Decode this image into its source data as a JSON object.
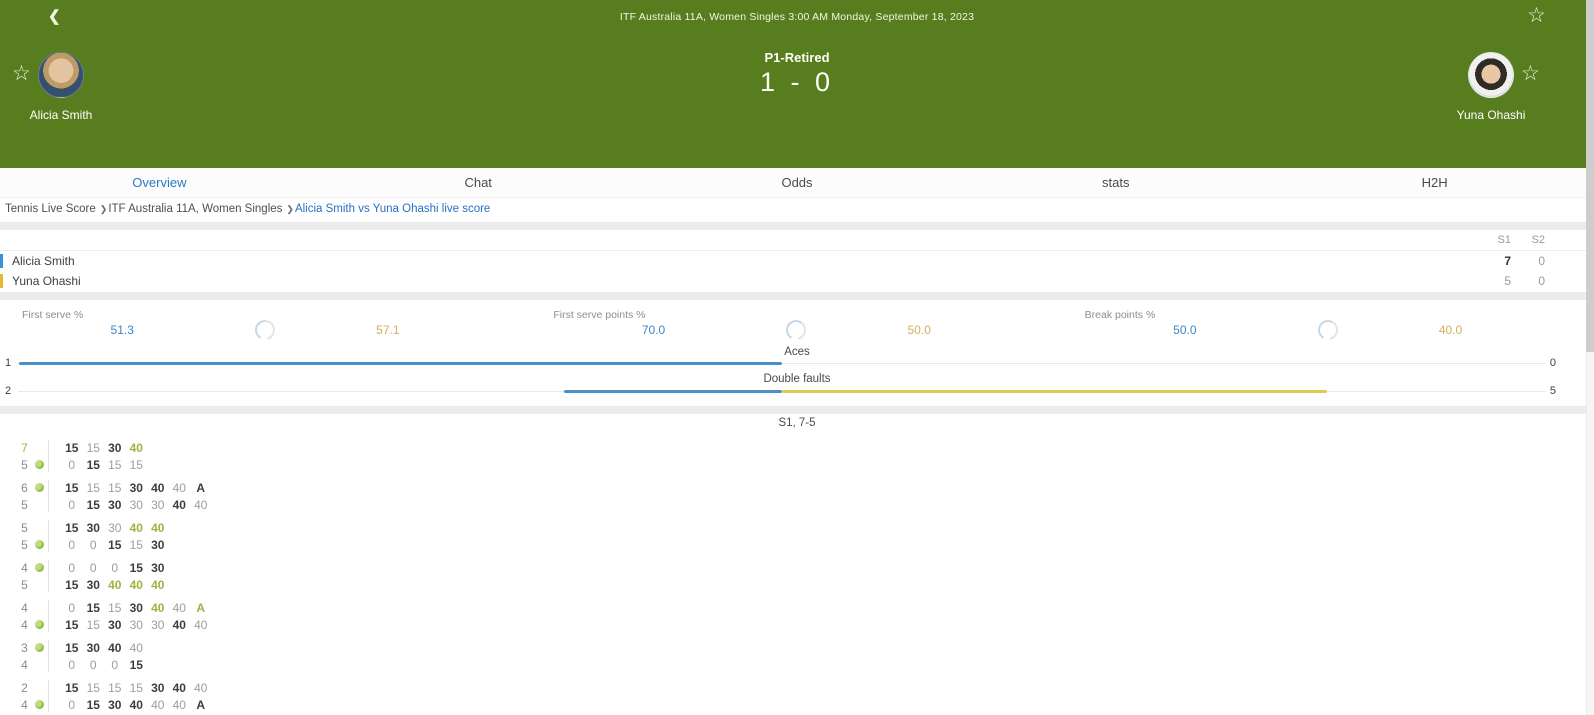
{
  "icons": {
    "back": "❮",
    "star": "☆",
    "serve_ball": "tennis-ball",
    "separator": "❯"
  },
  "header": {
    "bg_color": "#587d1f",
    "title": "ITF Australia 11A, Women Singles 3:00 AM Monday, September 18, 2023",
    "status": "P1-Retired",
    "score": "1 - 0",
    "home_name": "Alicia Smith",
    "away_name": "Yuna Ohashi"
  },
  "tabs": [
    {
      "label": "Overview",
      "active": true
    },
    {
      "label": "Chat",
      "active": false
    },
    {
      "label": "Odds",
      "active": false
    },
    {
      "label": "stats",
      "active": false
    },
    {
      "label": "H2H",
      "active": false
    }
  ],
  "breadcrumb": {
    "items": [
      {
        "label": "Tennis Live Score",
        "link": false
      },
      {
        "label": "ITF Australia 11A, Women Singles",
        "link": false
      },
      {
        "label": "Alicia Smith vs Yuna Ohashi live score",
        "link": true
      }
    ]
  },
  "score_table": {
    "columns": [
      "S1",
      "S2"
    ],
    "rows": [
      {
        "name": "Alicia Smith",
        "marker_color": "#3f8fd4",
        "sets": [
          {
            "value": "7",
            "highlight": true
          },
          {
            "value": "0",
            "highlight": false
          }
        ]
      },
      {
        "name": "Yuna Ohashi",
        "marker_color": "#e8b92e",
        "sets": [
          {
            "value": "5",
            "highlight": false
          },
          {
            "value": "0",
            "highlight": false
          }
        ]
      }
    ]
  },
  "percent_stats": [
    {
      "label": "First serve %",
      "home": "51.3",
      "away": "57.1"
    },
    {
      "label": "First serve points %",
      "home": "70.0",
      "away": "50.0"
    },
    {
      "label": "Break points %",
      "home": "50.0",
      "away": "40.0"
    }
  ],
  "bar_stats": [
    {
      "label": "Aces",
      "home": 1,
      "away": 0
    },
    {
      "label": "Double faults",
      "home": 2,
      "away": 5
    }
  ],
  "colors": {
    "home_value": "#3d85c8",
    "away_value": "#d9ab62",
    "home_bar": "#4a8fc7",
    "away_bar": "#e3c84f",
    "green": "#9cb440"
  },
  "set_history": {
    "title": "S1, 7-5",
    "games": [
      {
        "home": {
          "games": "7",
          "won": true,
          "serving": false,
          "points": [
            [
              "15",
              "d"
            ],
            [
              "15",
              "g"
            ],
            [
              "30",
              "d"
            ],
            [
              "40",
              "w"
            ]
          ]
        },
        "away": {
          "games": "5",
          "won": false,
          "serving": true,
          "points": [
            [
              "0",
              "g"
            ],
            [
              "15",
              "d"
            ],
            [
              "15",
              "g"
            ],
            [
              "15",
              "g"
            ]
          ]
        }
      },
      {
        "home": {
          "games": "6",
          "won": false,
          "serving": true,
          "points": [
            [
              "15",
              "d"
            ],
            [
              "15",
              "g"
            ],
            [
              "15",
              "g"
            ],
            [
              "30",
              "d"
            ],
            [
              "40",
              "d"
            ],
            [
              "40",
              "g"
            ],
            [
              "A",
              "d"
            ]
          ]
        },
        "away": {
          "games": "5",
          "won": false,
          "serving": false,
          "points": [
            [
              "0",
              "g"
            ],
            [
              "15",
              "d"
            ],
            [
              "30",
              "d"
            ],
            [
              "30",
              "g"
            ],
            [
              "30",
              "g"
            ],
            [
              "40",
              "d"
            ],
            [
              "40",
              "g"
            ]
          ]
        }
      },
      {
        "home": {
          "games": "5",
          "won": false,
          "serving": false,
          "points": [
            [
              "15",
              "d"
            ],
            [
              "30",
              "d"
            ],
            [
              "30",
              "g"
            ],
            [
              "40",
              "w"
            ],
            [
              "40",
              "w"
            ]
          ]
        },
        "away": {
          "games": "5",
          "won": false,
          "serving": true,
          "points": [
            [
              "0",
              "g"
            ],
            [
              "0",
              "g"
            ],
            [
              "15",
              "d"
            ],
            [
              "15",
              "g"
            ],
            [
              "30",
              "d"
            ]
          ]
        }
      },
      {
        "home": {
          "games": "4",
          "won": false,
          "serving": true,
          "points": [
            [
              "0",
              "g"
            ],
            [
              "0",
              "g"
            ],
            [
              "0",
              "g"
            ],
            [
              "15",
              "d"
            ],
            [
              "30",
              "d"
            ]
          ]
        },
        "away": {
          "games": "5",
          "won": false,
          "serving": false,
          "points": [
            [
              "15",
              "d"
            ],
            [
              "30",
              "d"
            ],
            [
              "40",
              "w"
            ],
            [
              "40",
              "w"
            ],
            [
              "40",
              "w"
            ]
          ]
        }
      },
      {
        "home": {
          "games": "4",
          "won": false,
          "serving": false,
          "points": [
            [
              "0",
              "g"
            ],
            [
              "15",
              "d"
            ],
            [
              "15",
              "g"
            ],
            [
              "30",
              "d"
            ],
            [
              "40",
              "w"
            ],
            [
              "40",
              "g"
            ],
            [
              "A",
              "w"
            ]
          ]
        },
        "away": {
          "games": "4",
          "won": false,
          "serving": true,
          "points": [
            [
              "15",
              "d"
            ],
            [
              "15",
              "g"
            ],
            [
              "30",
              "d"
            ],
            [
              "30",
              "g"
            ],
            [
              "30",
              "g"
            ],
            [
              "40",
              "d"
            ],
            [
              "40",
              "g"
            ]
          ]
        }
      },
      {
        "home": {
          "games": "3",
          "won": false,
          "serving": true,
          "points": [
            [
              "15",
              "d"
            ],
            [
              "30",
              "d"
            ],
            [
              "40",
              "d"
            ],
            [
              "40",
              "g"
            ]
          ]
        },
        "away": {
          "games": "4",
          "won": false,
          "serving": false,
          "points": [
            [
              "0",
              "g"
            ],
            [
              "0",
              "g"
            ],
            [
              "0",
              "g"
            ],
            [
              "15",
              "d"
            ]
          ]
        }
      },
      {
        "home": {
          "games": "2",
          "won": false,
          "serving": false,
          "points": [
            [
              "15",
              "d"
            ],
            [
              "15",
              "g"
            ],
            [
              "15",
              "g"
            ],
            [
              "15",
              "g"
            ],
            [
              "30",
              "d"
            ],
            [
              "40",
              "d"
            ],
            [
              "40",
              "g"
            ]
          ]
        },
        "away": {
          "games": "4",
          "won": false,
          "serving": true,
          "points": [
            [
              "0",
              "g"
            ],
            [
              "15",
              "d"
            ],
            [
              "30",
              "d"
            ],
            [
              "40",
              "d"
            ],
            [
              "40",
              "g"
            ],
            [
              "40",
              "g"
            ],
            [
              "A",
              "d"
            ]
          ]
        }
      }
    ]
  }
}
